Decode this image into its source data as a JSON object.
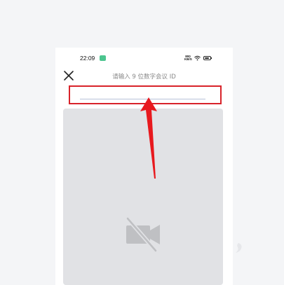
{
  "status_bar": {
    "time": "22:09",
    "network_speed_value": "800",
    "network_speed_unit": "KB/S",
    "battery_level": 0.8
  },
  "header": {
    "title": "请输入 9 位数字会议 ID"
  },
  "meeting_id_input": {
    "value": "",
    "placeholder": ""
  },
  "icons": {
    "close": "close-icon",
    "camera_off": "camera-off-icon",
    "wifi": "wifi-icon",
    "battery": "battery-icon",
    "notification": "notification-icon"
  },
  "colors": {
    "highlight_border": "#d8232a",
    "arrow": "#e8191e",
    "preview_bg": "#e1e2e5",
    "input_underline": "#b8c3d9",
    "notification_badge": "#4cc58f"
  }
}
